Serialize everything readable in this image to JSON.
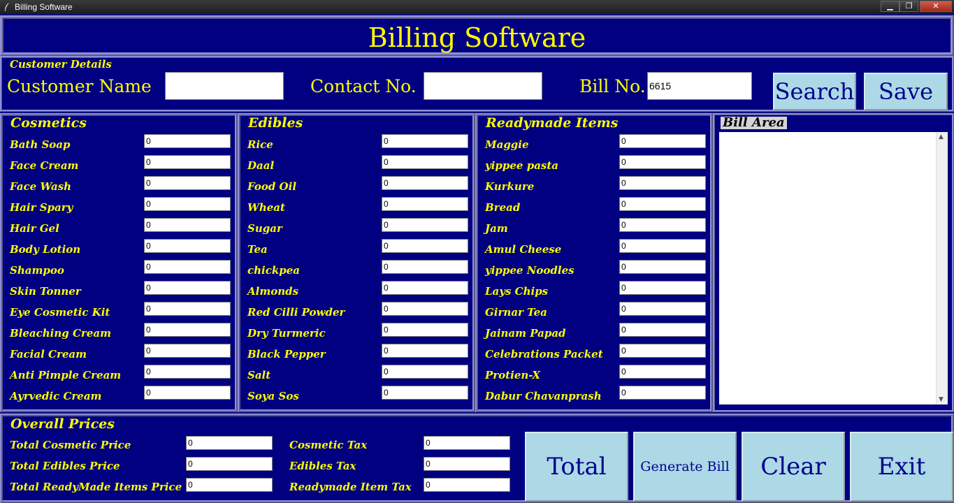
{
  "window": {
    "title": "Billing Software",
    "minimize": "▁",
    "maximize": "❐",
    "close": "✕"
  },
  "app_title": "Billing Software",
  "customer": {
    "section_title": "Customer Details",
    "name_label": "Customer Name",
    "name_value": "",
    "contact_label": "Contact No.",
    "contact_value": "",
    "bill_label": "Bill No.",
    "bill_value": "6615",
    "search_button": "Search",
    "save_button": "Save"
  },
  "cosmetics": {
    "title": "Cosmetics",
    "items": [
      {
        "label": "Bath Soap",
        "value": "0"
      },
      {
        "label": "Face Cream",
        "value": "0"
      },
      {
        "label": "Face Wash",
        "value": "0"
      },
      {
        "label": "Hair Spary",
        "value": "0"
      },
      {
        "label": "Hair Gel",
        "value": "0"
      },
      {
        "label": "Body Lotion",
        "value": "0"
      },
      {
        "label": "Shampoo",
        "value": "0"
      },
      {
        "label": "Skin Tonner",
        "value": "0"
      },
      {
        "label": "Eye Cosmetic Kit",
        "value": "0"
      },
      {
        "label": "Bleaching Cream",
        "value": "0"
      },
      {
        "label": "Facial Cream",
        "value": "0"
      },
      {
        "label": "Anti Pimple Cream",
        "value": "0"
      },
      {
        "label": "Ayrvedic Cream",
        "value": "0"
      }
    ]
  },
  "edibles": {
    "title": "Edibles",
    "items": [
      {
        "label": "Rice",
        "value": "0"
      },
      {
        "label": "Daal",
        "value": "0"
      },
      {
        "label": "Food Oil",
        "value": "0"
      },
      {
        "label": "Wheat",
        "value": "0"
      },
      {
        "label": "Sugar",
        "value": "0"
      },
      {
        "label": "Tea",
        "value": "0"
      },
      {
        "label": "chickpea",
        "value": "0"
      },
      {
        "label": "Almonds",
        "value": "0"
      },
      {
        "label": "Red Cilli Powder",
        "value": "0"
      },
      {
        "label": "Dry Turmeric",
        "value": "0"
      },
      {
        "label": "Black Pepper",
        "value": "0"
      },
      {
        "label": "Salt",
        "value": "0"
      },
      {
        "label": "Soya Sos",
        "value": "0"
      }
    ]
  },
  "readymade": {
    "title": "Readymade Items",
    "items": [
      {
        "label": "Maggie",
        "value": "0"
      },
      {
        "label": "yippee pasta",
        "value": "0"
      },
      {
        "label": "Kurkure",
        "value": "0"
      },
      {
        "label": "Bread",
        "value": "0"
      },
      {
        "label": "Jam",
        "value": "0"
      },
      {
        "label": "Amul Cheese",
        "value": "0"
      },
      {
        "label": "yippee Noodles",
        "value": "0"
      },
      {
        "label": "Lays Chips",
        "value": "0"
      },
      {
        "label": "Girnar Tea",
        "value": "0"
      },
      {
        "label": "Jainam Papad",
        "value": "0"
      },
      {
        "label": "Celebrations Packet",
        "value": "0"
      },
      {
        "label": "Protien-X",
        "value": "0"
      },
      {
        "label": "Dabur Chavanprash",
        "value": "0"
      }
    ]
  },
  "bill_area": {
    "title": "Bill Area",
    "content": ""
  },
  "overall": {
    "title": "Overall Prices",
    "total_cosmetic_label": "Total Cosmetic Price",
    "total_cosmetic_value": "0",
    "total_edibles_label": "Total Edibles Price",
    "total_edibles_value": "0",
    "total_readymade_label": "Total ReadyMade Items Price",
    "total_readymade_value": "0",
    "cosmetic_tax_label": "Cosmetic Tax",
    "cosmetic_tax_value": "0",
    "edibles_tax_label": "Edibles Tax",
    "edibles_tax_value": "0",
    "readymade_tax_label": "Readymade Item Tax",
    "readymade_tax_value": "0",
    "total_button": "Total",
    "generate_button": "Generate Bill",
    "clear_button": "Clear",
    "exit_button": "Exit"
  }
}
